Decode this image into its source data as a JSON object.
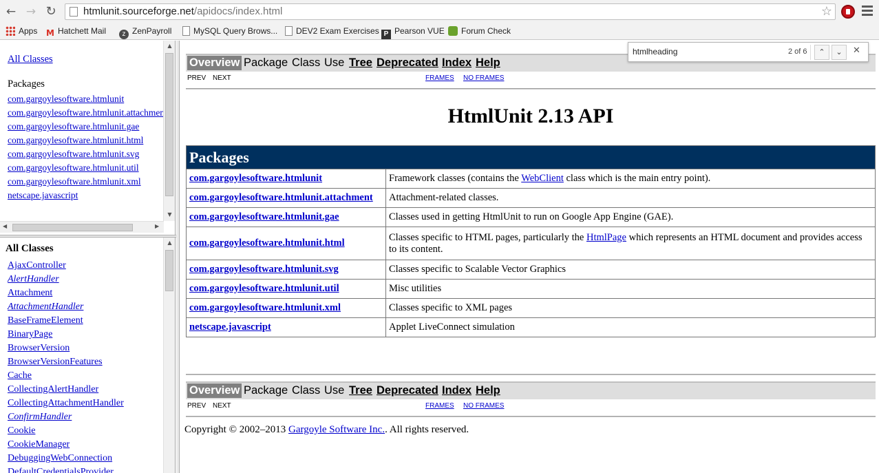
{
  "browser": {
    "url_host": "htmlunit.sourceforge.net",
    "url_path": "/apidocs/index.html",
    "bookmarks": [
      {
        "label": "Apps",
        "icon": "apps-icon"
      },
      {
        "label": "Hatchett Mail",
        "icon": "gmail-icon"
      },
      {
        "label": "ZenPayroll",
        "icon": "zenpayroll-icon"
      },
      {
        "label": "MySQL Query Brows...",
        "icon": "page-icon"
      },
      {
        "label": "DEV2 Exam Exercises",
        "icon": "page-icon"
      },
      {
        "label": "Pearson VUE",
        "icon": "pearson-icon"
      },
      {
        "label": "Forum Check",
        "icon": "puzzle-icon"
      }
    ]
  },
  "find_bar": {
    "query": "htmlheading",
    "count": "2 of 6"
  },
  "package_frame": {
    "all_classes_link": "All Classes",
    "heading": "Packages",
    "packages": [
      "com.gargoylesoftware.htmlunit",
      "com.gargoylesoftware.htmlunit.attachment",
      "com.gargoylesoftware.htmlunit.gae",
      "com.gargoylesoftware.htmlunit.html",
      "com.gargoylesoftware.htmlunit.svg",
      "com.gargoylesoftware.htmlunit.util",
      "com.gargoylesoftware.htmlunit.xml",
      "netscape.javascript"
    ]
  },
  "class_frame": {
    "heading": "All Classes",
    "classes": [
      {
        "name": "AjaxController",
        "italic": false
      },
      {
        "name": "AlertHandler",
        "italic": true
      },
      {
        "name": "Attachment",
        "italic": false
      },
      {
        "name": "AttachmentHandler",
        "italic": true
      },
      {
        "name": "BaseFrameElement",
        "italic": false
      },
      {
        "name": "BinaryPage",
        "italic": false
      },
      {
        "name": "BrowserVersion",
        "italic": false
      },
      {
        "name": "BrowserVersionFeatures",
        "italic": false
      },
      {
        "name": "Cache",
        "italic": false
      },
      {
        "name": "CollectingAlertHandler",
        "italic": false
      },
      {
        "name": "CollectingAttachmentHandler",
        "italic": false
      },
      {
        "name": "ConfirmHandler",
        "italic": true
      },
      {
        "name": "Cookie",
        "italic": false
      },
      {
        "name": "CookieManager",
        "italic": false
      },
      {
        "name": "DebuggingWebConnection",
        "italic": false
      },
      {
        "name": "DefaultCredentialsProvider",
        "italic": false
      }
    ]
  },
  "main": {
    "nav": {
      "overview": "Overview",
      "package": "Package",
      "class": "Class",
      "use": "Use",
      "tree": "Tree",
      "deprecated": "Deprecated",
      "index": "Index",
      "help": "Help"
    },
    "subnav": {
      "prev": "PREV",
      "next": "NEXT",
      "frames": "FRAMES",
      "no_frames": "NO FRAMES"
    },
    "title": "HtmlUnit 2.13 API",
    "table_heading": "Packages",
    "rows": [
      {
        "name": "com.gargoylesoftware.htmlunit",
        "desc_before": "Framework classes (contains the ",
        "desc_link": "WebClient",
        "desc_after": " class which is the main entry point)."
      },
      {
        "name": "com.gargoylesoftware.htmlunit.attachment",
        "desc_before": "Attachment-related classes.",
        "desc_link": "",
        "desc_after": ""
      },
      {
        "name": "com.gargoylesoftware.htmlunit.gae",
        "desc_before": "Classes used in getting HtmlUnit to run on Google App Engine (GAE).",
        "desc_link": "",
        "desc_after": ""
      },
      {
        "name": "com.gargoylesoftware.htmlunit.html",
        "desc_before": "Classes specific to HTML pages, particularly the ",
        "desc_link": "HtmlPage",
        "desc_after": " which represents an HTML document and provides access to its content."
      },
      {
        "name": "com.gargoylesoftware.htmlunit.svg",
        "desc_before": "Classes specific to Scalable Vector Graphics",
        "desc_link": "",
        "desc_after": ""
      },
      {
        "name": "com.gargoylesoftware.htmlunit.util",
        "desc_before": "Misc utilities",
        "desc_link": "",
        "desc_after": ""
      },
      {
        "name": "com.gargoylesoftware.htmlunit.xml",
        "desc_before": "Classes specific to XML pages",
        "desc_link": "",
        "desc_after": ""
      },
      {
        "name": "netscape.javascript",
        "desc_before": "Applet LiveConnect simulation",
        "desc_link": "",
        "desc_after": ""
      }
    ],
    "copyright_before": "Copyright © 2002–2013 ",
    "copyright_link": "Gargoyle Software Inc.",
    "copyright_after": ". All rights reserved."
  },
  "colors": {
    "table_header_bg": "#00305e",
    "link": "#0000cc",
    "nav_current_bg": "#808080"
  }
}
